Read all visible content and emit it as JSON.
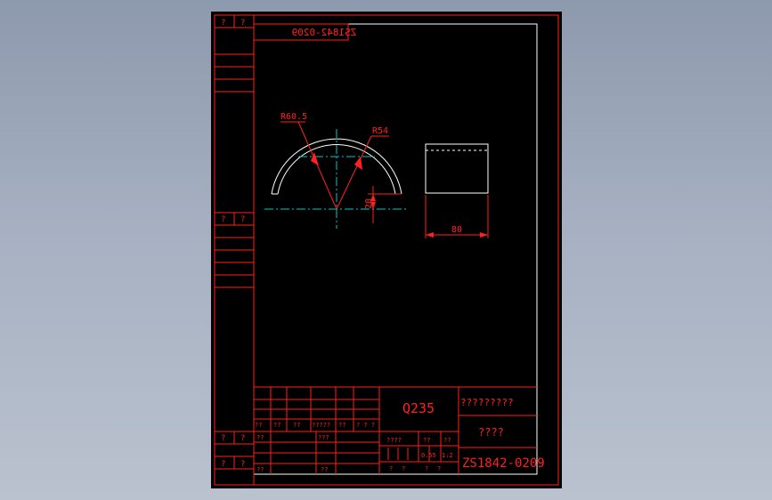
{
  "drawing": {
    "number_mirrored": "ZS1842-0209",
    "number": "ZS1842-0209",
    "material": "Q235",
    "name": "?????????",
    "company": "????",
    "dimensions": {
      "outer_radius": "R60.5",
      "inner_radius": "R54",
      "height": "20",
      "length": "80"
    },
    "side_labels": {
      "top_left": "?",
      "top_right": "?",
      "mid_left": "?",
      "mid_right": "?",
      "low_left": "?",
      "low_right": "?",
      "bottom_left": "?",
      "bottom_right": "?"
    },
    "title_block": {
      "rev_labels": [
        "??",
        "??",
        "??",
        "?????",
        "??",
        "? ? ?"
      ],
      "designer": "??",
      "checker": "???",
      "approver": "??",
      "stage_label": "????",
      "weight_label": "??",
      "scale_label": "??",
      "scale_value": "0.55",
      "scale_ratio": "1:2",
      "sheet_left": "?",
      "sheet_right": "?",
      "total_left": "?",
      "total_right": "?"
    },
    "colors": {
      "frame": "#ff2020",
      "outline": "#ffffff",
      "centerline": "#00c8c8",
      "background": "#000000"
    }
  }
}
